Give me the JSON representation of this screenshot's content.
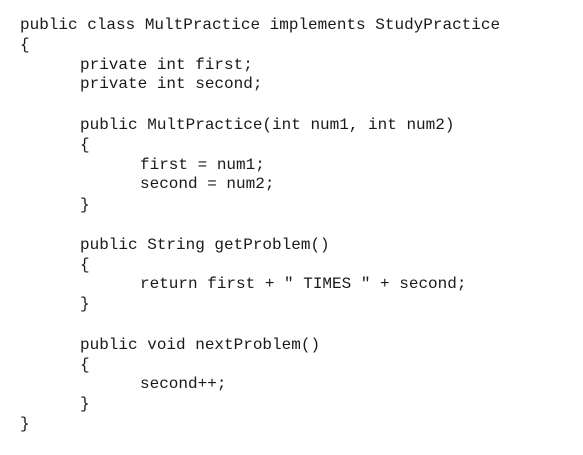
{
  "code": {
    "lines": [
      "public class MultPractice implements StudyPractice",
      "{",
      "private int first;",
      "private int second;",
      "public MultPractice(int num1, int num2)",
      "{",
      "first = num1;",
      "second = num2;",
      "}",
      "public String getProblem()",
      "{",
      "return first + \" TIMES \" + second;",
      "}",
      "public void nextProblem()",
      "{",
      "second++;",
      "}",
      "}"
    ]
  }
}
